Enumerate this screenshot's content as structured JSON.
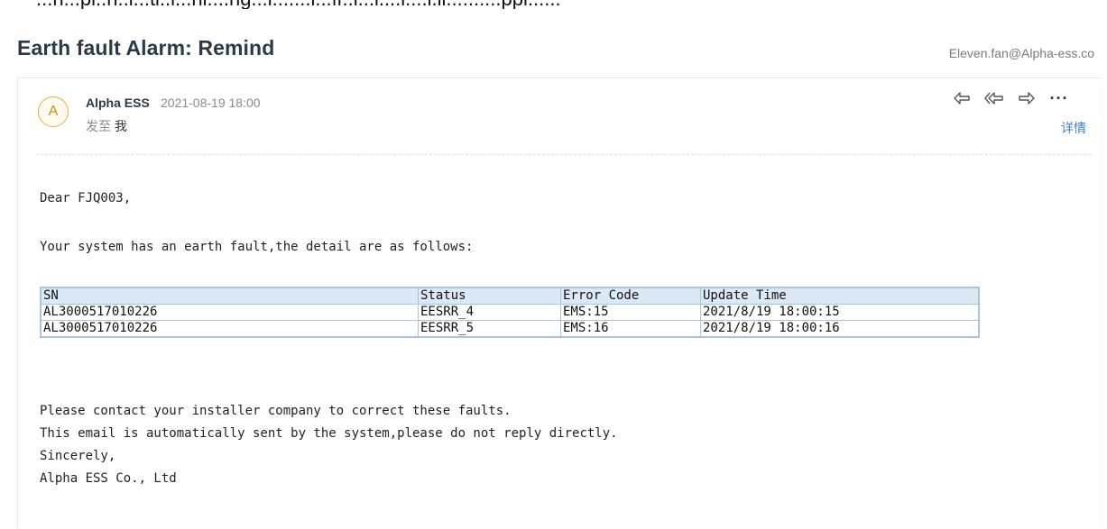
{
  "top_clipped_text": "...n...pl..n..i...ti..l...ni....ng...i.......i...ff..l...i....l....i.li..........ppl......",
  "email": {
    "subject": "Earth fault Alarm: Remind",
    "recipient_address": "Eleven.fan@Alpha-ess.co",
    "avatar_letter": "A",
    "sender_name": "Alpha ESS",
    "date": "2021-08-19 18:00",
    "sent_to_label": "发至",
    "sent_to_value": "我",
    "details_link": "详情",
    "actions": [
      "reply-icon",
      "reply-all-icon",
      "forward-icon",
      "more-icon"
    ],
    "more_label": "···"
  },
  "body": {
    "greeting": "Dear FJQ003,",
    "intro": "Your system has an earth fault,the detail are as follows:",
    "table": {
      "headers": [
        "SN",
        "Status",
        "Error Code",
        "Update Time"
      ],
      "rows": [
        [
          "AL3000517010226",
          "EESRR_4",
          "EMS:15",
          "2021/8/19 18:00:15"
        ],
        [
          "AL3000517010226",
          "EESRR_5",
          "EMS:16",
          "2021/8/19 18:00:16"
        ]
      ]
    },
    "closing_lines": [
      "Please contact your installer company to correct these faults.",
      "This email is automatically sent by the system,please do not reply directly.",
      "Sincerely,",
      "Alpha ESS Co., Ltd"
    ]
  },
  "colors": {
    "table_border": "#a7c4e0",
    "table_header_bg": "#dbe8f5",
    "link": "#3b82c4",
    "avatar_border": "#e3b23c"
  }
}
